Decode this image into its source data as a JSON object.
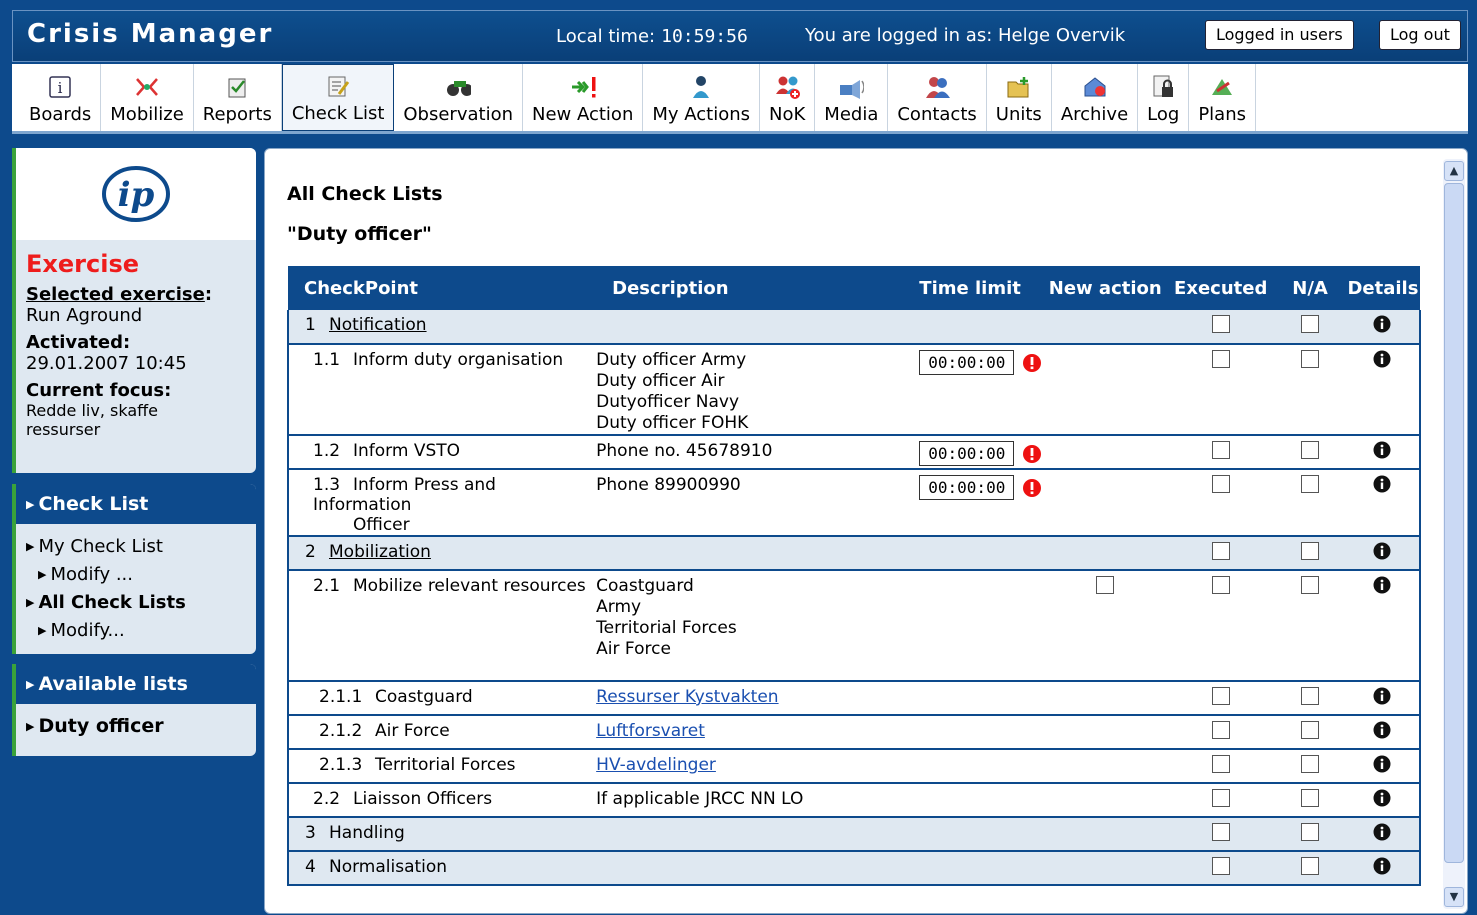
{
  "header": {
    "app_title": "Crisis Manager",
    "local_time_label": "Local time:",
    "local_time": "10:59:56",
    "logged_as": "You are logged in as:  Helge Overvik",
    "logged_users_btn": "Logged in users",
    "logout_btn": "Log out"
  },
  "toolbar": [
    {
      "label": "Boards",
      "icon": "info-board-icon"
    },
    {
      "label": "Mobilize",
      "icon": "mobilize-icon"
    },
    {
      "label": "Reports",
      "icon": "reports-icon"
    },
    {
      "label": "Check List",
      "icon": "checklist-icon"
    },
    {
      "label": "Observation",
      "icon": "binoculars-icon"
    },
    {
      "label": "New Action",
      "icon": "new-action-icon"
    },
    {
      "label": "My Actions",
      "icon": "person-icon"
    },
    {
      "label": "NoK",
      "icon": "nok-icon"
    },
    {
      "label": "Media",
      "icon": "media-icon"
    },
    {
      "label": "Contacts",
      "icon": "contacts-icon"
    },
    {
      "label": "Units",
      "icon": "units-icon"
    },
    {
      "label": "Archive",
      "icon": "archive-icon"
    },
    {
      "label": "Log",
      "icon": "log-icon"
    },
    {
      "label": "Plans",
      "icon": "plans-icon"
    }
  ],
  "sidebar": {
    "logo": "ip",
    "exercise": "Exercise",
    "selected_label": "Selected exercise",
    "selected_value": "Run Aground",
    "activated_label": "Activated:",
    "activated_value": "29.01.2007 10:45",
    "focus_label": "Current focus:",
    "focus_value1": "Redde liv, skaffe",
    "focus_value2": "ressurser",
    "checklist_head": "Check List",
    "my_checklist": "My Check List",
    "modify1": "Modify ...",
    "all_checklists": "All Check Lists",
    "modify2": "Modify...",
    "available_head": "Available lists",
    "duty_officer": "Duty officer"
  },
  "main": {
    "title": "All Check Lists",
    "subtitle": "\"Duty officer\"",
    "columns": {
      "checkpoint": "CheckPoint",
      "description": "Description",
      "time_limit": "Time limit",
      "new_action": "New action",
      "executed": "Executed",
      "na": "N/A",
      "details": "Details"
    },
    "rows": [
      {
        "num": "1",
        "name": "Notification"
      },
      {
        "num": "1.1",
        "name": "Inform duty organisation",
        "desc": [
          "Duty officer Army",
          "Duty officer Air",
          "Dutyofficer Navy",
          "Duty officer FOHK"
        ],
        "time": "00:00:00"
      },
      {
        "num": "1.2",
        "name": "Inform VSTO",
        "desc": "Phone no. 45678910",
        "time": "00:00:00"
      },
      {
        "num": "1.3",
        "name": "Inform Press and Information",
        "name2": "Officer",
        "desc": "Phone 89900990",
        "time": "00:00:00"
      },
      {
        "num": "2",
        "name": "Mobilization"
      },
      {
        "num": "2.1",
        "name": "Mobilize relevant resources",
        "desc": [
          "Coastguard",
          "Army",
          "Territorial Forces",
          "Air Force"
        ]
      },
      {
        "num": "2.1.1",
        "name": "Coastguard",
        "desc": "Ressurser Kystvakten"
      },
      {
        "num": "2.1.2",
        "name": "Air Force",
        "desc": "Luftforsvaret"
      },
      {
        "num": "2.1.3",
        "name": "Territorial Forces",
        "desc": "HV-avdelinger"
      },
      {
        "num": "2.2",
        "name": "Liaisson Officers",
        "desc": "If applicable JRCC NN LO"
      },
      {
        "num": "3",
        "name": "Handling"
      },
      {
        "num": "4",
        "name": "Normalisation"
      }
    ]
  }
}
